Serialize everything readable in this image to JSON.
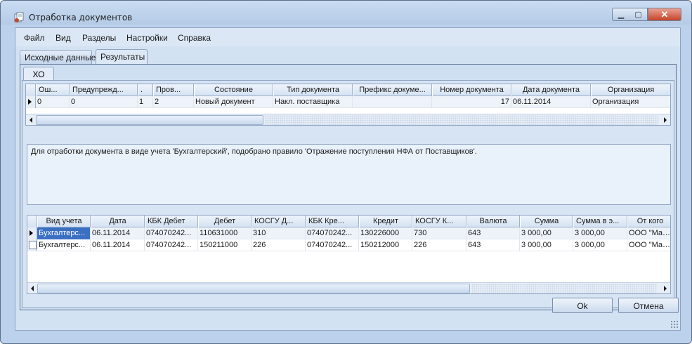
{
  "window": {
    "title": "Отработка документов"
  },
  "menu": [
    "Файл",
    "Вид",
    "Разделы",
    "Настройки",
    "Справка"
  ],
  "tabs": [
    {
      "label": "Исходные данные",
      "active": false
    },
    {
      "label": "Результаты",
      "active": true
    }
  ],
  "inner_tab": {
    "label": "ХО"
  },
  "top_grid": {
    "columns": [
      "Ош...",
      "Предупрежд...",
      ".",
      "Пров...",
      "Состояние",
      "Тип документа",
      "Префикс докуме...",
      "Номер документа",
      "Дата документа",
      "Организация"
    ],
    "rows": [
      [
        "0",
        "0",
        "1",
        "2",
        "Новый документ",
        "Накл. поставщика",
        "",
        "17",
        "06.11.2014",
        "Организация"
      ]
    ]
  },
  "message": "Для отработки документа в виде учета 'Бухгалтерский', подобрано правило 'Отражение поступления НФА от Поставщиков'.",
  "bottom_grid": {
    "columns": [
      "Вид учета",
      "Дата",
      "КБК Дебет",
      "Дебет",
      "КОСГУ Д...",
      "КБК Кре...",
      "Кредит",
      "КОСГУ К...",
      "Валюта",
      "Сумма",
      "Сумма в э...",
      "От кого"
    ],
    "rows": [
      [
        "Бухгалтерс...",
        "06.11.2014",
        "074070242...",
        "110631000",
        "310",
        "074070242...",
        "130226000",
        "730",
        "643",
        "3 000,00",
        "3 000,00",
        "ООО \"Маст..."
      ],
      [
        "Бухгалтерс...",
        "06.11.2014",
        "074070242...",
        "150211000",
        "226",
        "074070242...",
        "150212000",
        "226",
        "643",
        "3 000,00",
        "3 000,00",
        "ООО \"Маст..."
      ]
    ]
  },
  "buttons": {
    "ok": "Ok",
    "cancel": "Отмена"
  },
  "icons": {
    "app": "documents-app-icon",
    "minimize": "minimize-icon",
    "maximize": "maximize-icon",
    "close": "close-icon",
    "row_current": "current-row-arrow-icon",
    "scroll_left": "scroll-left-icon",
    "scroll_right": "scroll-right-icon",
    "resize_grip": "resize-grip-icon"
  },
  "colors": {
    "window_bg": "#bcd2ec",
    "selection": "#3b6fc2",
    "close_button": "#c7432a"
  }
}
